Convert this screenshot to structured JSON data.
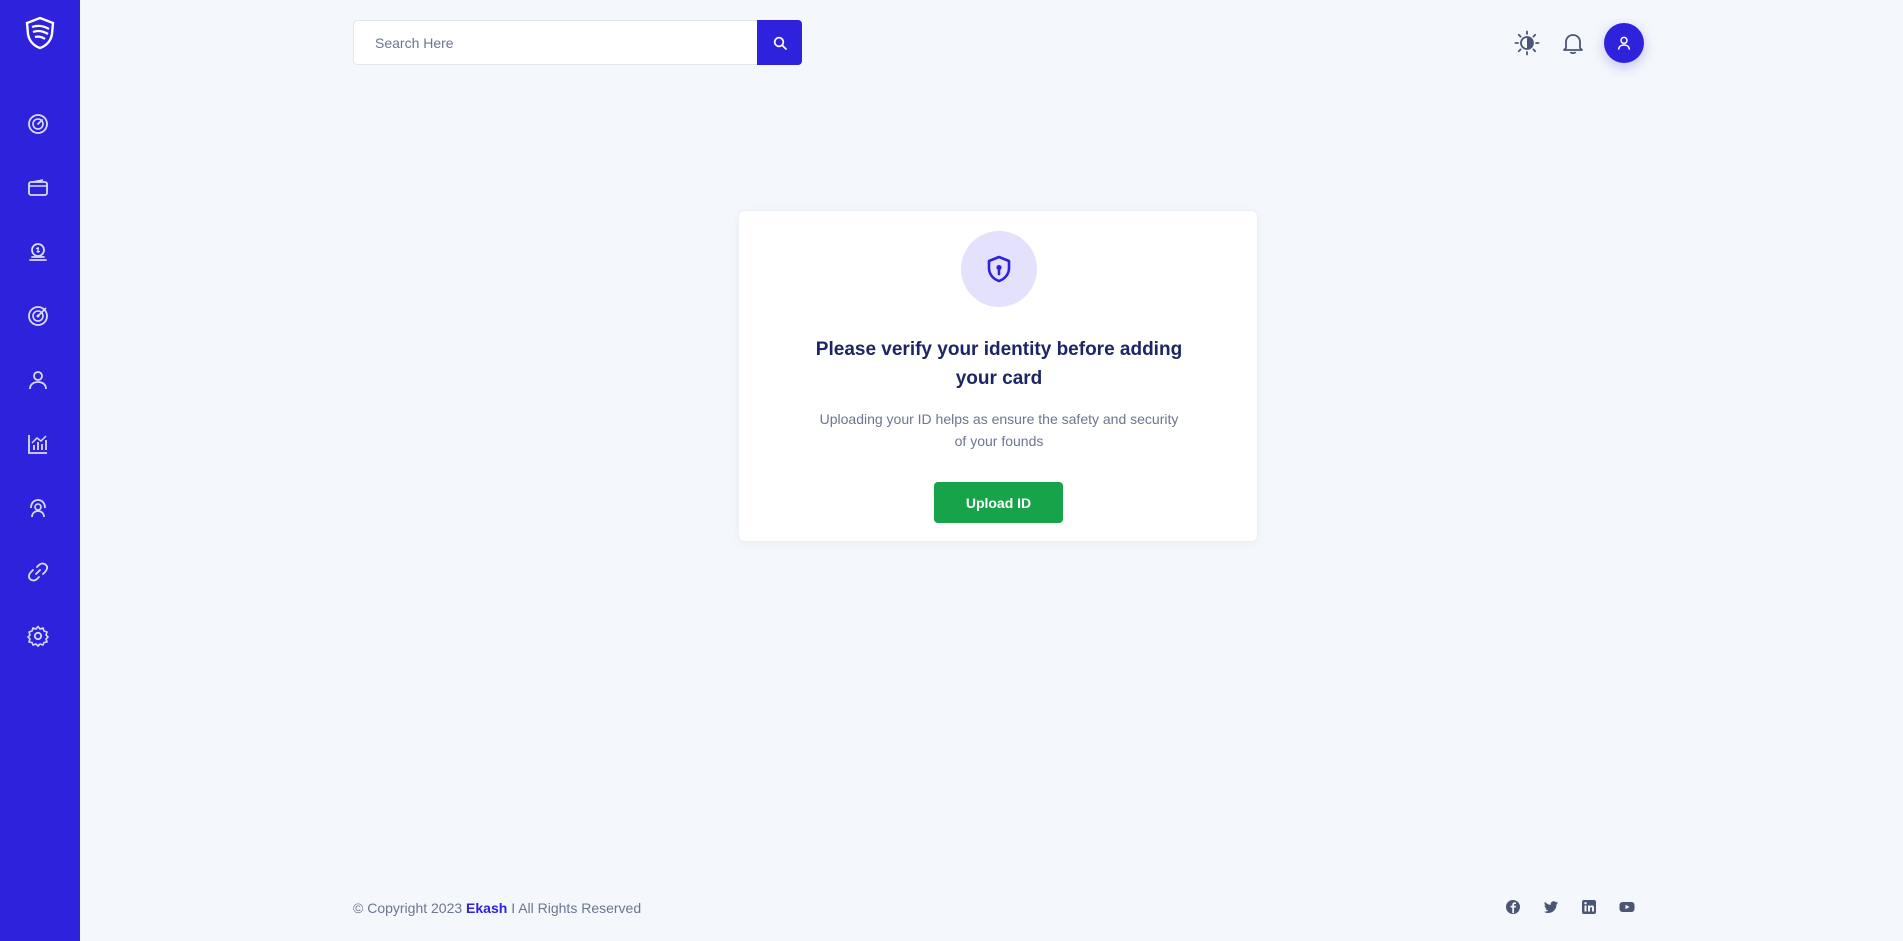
{
  "sidebar": {
    "logo_icon": "shield-logo-icon",
    "items": [
      {
        "name": "dashboard",
        "icon": "gauge-icon"
      },
      {
        "name": "wallet",
        "icon": "wallet-icon"
      },
      {
        "name": "payments",
        "icon": "money-hand-icon"
      },
      {
        "name": "goals",
        "icon": "target-icon"
      },
      {
        "name": "profile",
        "icon": "user-icon"
      },
      {
        "name": "analytics",
        "icon": "bar-chart-icon"
      },
      {
        "name": "support",
        "icon": "headset-icon"
      },
      {
        "name": "links",
        "icon": "link-icon"
      },
      {
        "name": "settings",
        "icon": "gear-icon"
      }
    ]
  },
  "header": {
    "search": {
      "placeholder": "Search Here",
      "value": ""
    },
    "icons": [
      "theme-toggle-icon",
      "bell-icon",
      "user-avatar-icon"
    ]
  },
  "card": {
    "title": "Please verify your identity before adding your card",
    "description": "Uploading your ID helps as ensure the safety and security of your founds",
    "button_label": "Upload ID",
    "icon": "shield-lock-icon"
  },
  "footer": {
    "copyright_prefix": "© Copyright 2023",
    "brand": "Ekash",
    "copyright_suffix": "I All Rights Reserved",
    "social": [
      "facebook-icon",
      "twitter-icon",
      "linkedin-icon",
      "youtube-icon"
    ]
  },
  "colors": {
    "primary": "#2f22dc",
    "background": "#f4f7fb",
    "success": "#16a34a",
    "heading": "#1d2563",
    "muted": "#6b7690"
  }
}
